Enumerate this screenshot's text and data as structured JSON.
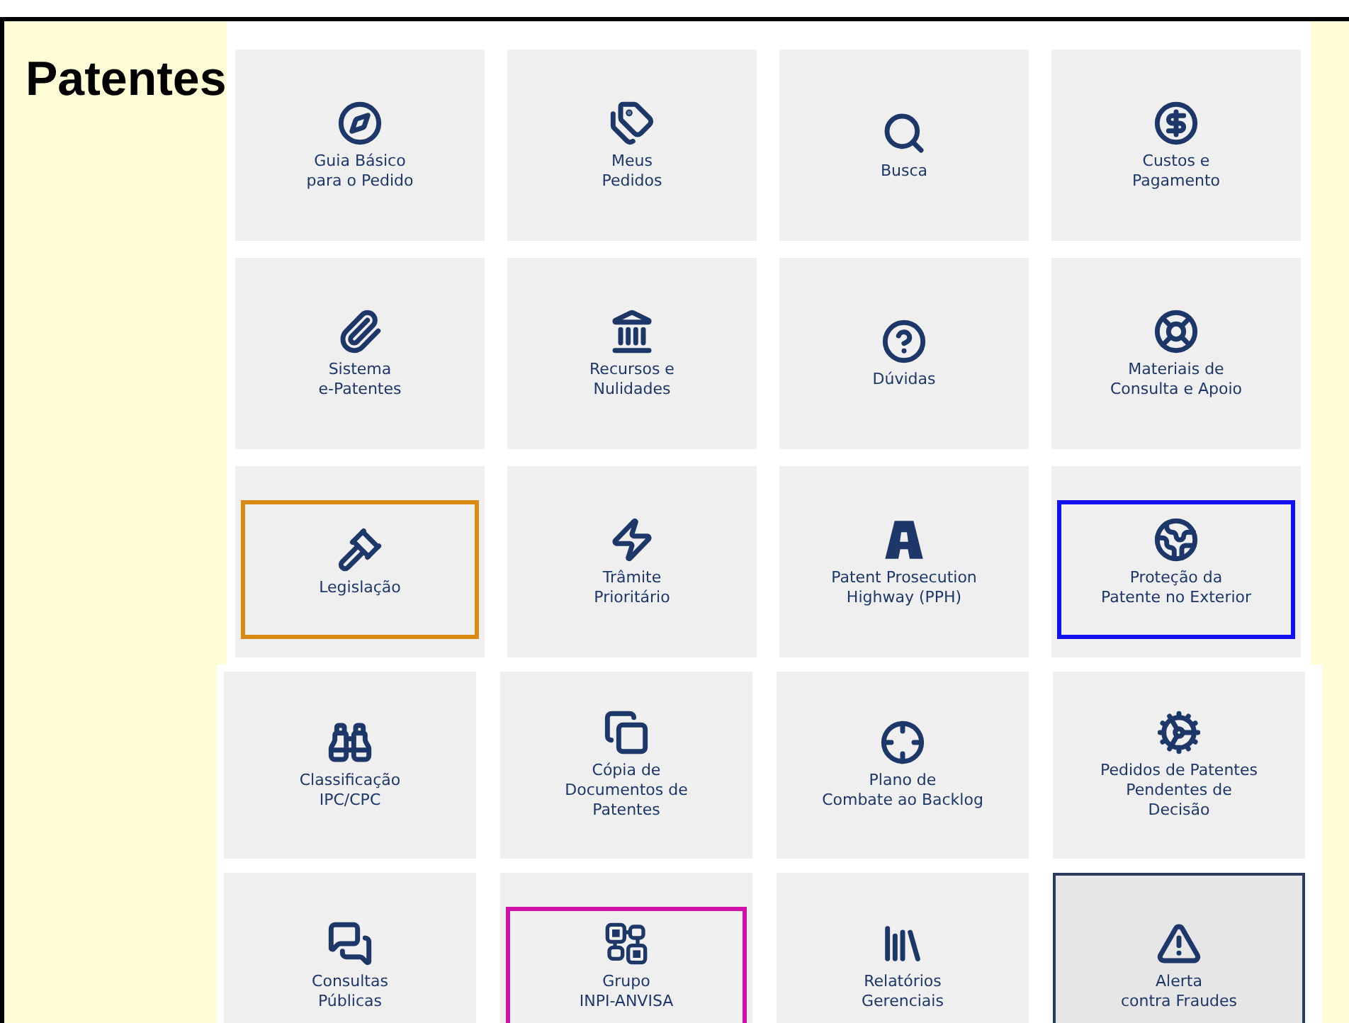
{
  "title": "Patentes",
  "sections": [
    {
      "tiles": [
        {
          "label": "Guia Básico\npara o Pedido",
          "selected": false
        },
        {
          "label": "Meus\nPedidos",
          "selected": false
        },
        {
          "label": "Busca",
          "selected": false
        },
        {
          "label": "Custos e\nPagamento",
          "selected": false
        },
        {
          "label": "Sistema\ne-Patentes",
          "selected": false
        },
        {
          "label": "Recursos e\nNulidades",
          "selected": false
        },
        {
          "label": "Dúvidas",
          "selected": false
        },
        {
          "label": "Materiais de\nConsulta e Apoio",
          "selected": false
        },
        {
          "label": "Legislação",
          "selected": false,
          "color": "#d98a14"
        },
        {
          "label": "Trâmite\nPrioritário",
          "selected": false
        },
        {
          "label": "Patent Prosecution\nHighway (PPH)",
          "selected": false
        },
        {
          "label": "Proteção da\nPatente no Exterior",
          "selected": false,
          "color": "#1010f0"
        }
      ]
    },
    {
      "tiles": [
        {
          "label": "Classificação\nIPC/CPC",
          "selected": false
        },
        {
          "label": "Cópia de\nDocumentos de\nPatentes",
          "selected": false
        },
        {
          "label": "Plano de\nCombate ao Backlog",
          "selected": false
        },
        {
          "label": "Pedidos de Patentes\nPendentes de\nDecisão",
          "selected": false
        },
        {
          "label": "Consultas\nPúblicas",
          "selected": false
        },
        {
          "label": "Grupo\nINPI-ANVISA",
          "selected": false,
          "color": "#d010a8"
        },
        {
          "label": "Relatórios\nGerenciais",
          "selected": false
        },
        {
          "label": "Alerta\ncontra Fraudes",
          "selected": true
        }
      ]
    }
  ]
}
